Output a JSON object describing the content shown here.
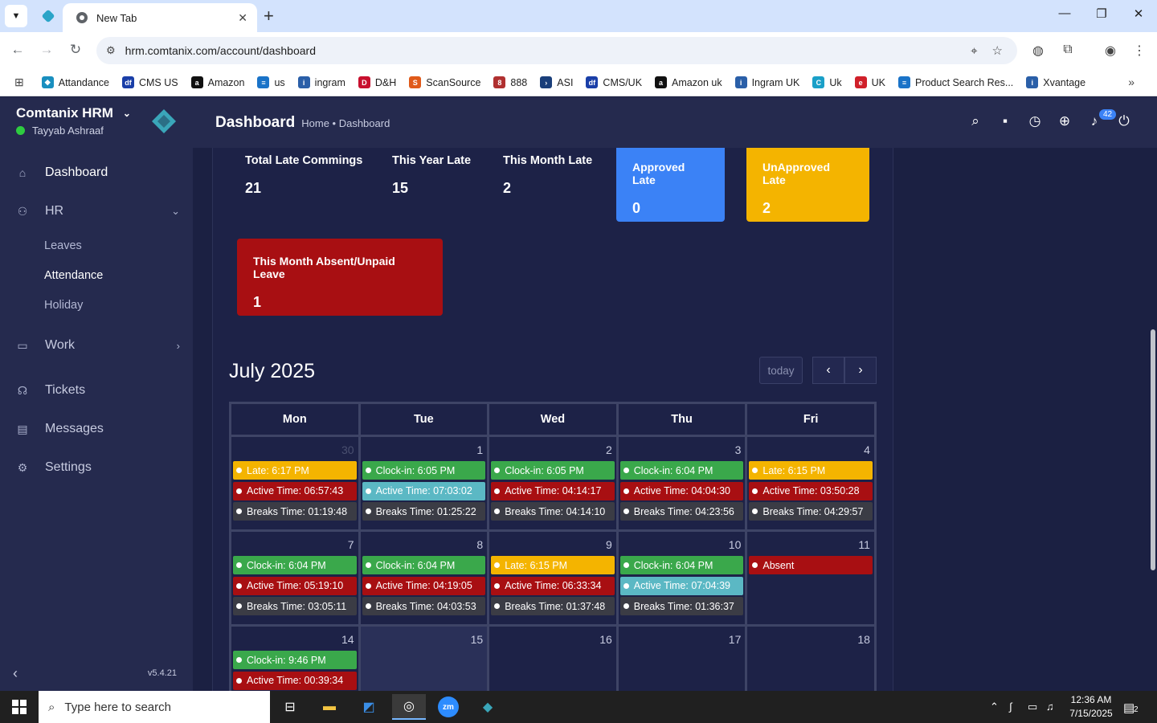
{
  "browser": {
    "tab_title": "New Tab",
    "url": "hrm.comtanix.com/account/dashboard",
    "bookmarks": [
      {
        "label": "Attandance",
        "color": "#1a8fbf",
        "glyph": "◆"
      },
      {
        "label": "CMS US",
        "color": "#1a3fa8",
        "glyph": "df"
      },
      {
        "label": "Amazon",
        "color": "#111111",
        "glyph": "a"
      },
      {
        "label": "us",
        "color": "#1a73c8",
        "glyph": "≡"
      },
      {
        "label": "ingram",
        "color": "#2a5fa8",
        "glyph": "i"
      },
      {
        "label": "D&H",
        "color": "#c8102e",
        "glyph": "D"
      },
      {
        "label": "ScanSource",
        "color": "#e05a1a",
        "glyph": "S"
      },
      {
        "label": "888",
        "color": "#b03030",
        "glyph": "8"
      },
      {
        "label": "ASI",
        "color": "#1a3f7a",
        "glyph": "›"
      },
      {
        "label": "CMS/UK",
        "color": "#1a3fa8",
        "glyph": "df"
      },
      {
        "label": "Amazon uk",
        "color": "#111111",
        "glyph": "a"
      },
      {
        "label": "Ingram UK",
        "color": "#2a5fa8",
        "glyph": "i"
      },
      {
        "label": "Uk",
        "color": "#1aa0c8",
        "glyph": "C"
      },
      {
        "label": "UK",
        "color": "#d0202a",
        "glyph": "e"
      },
      {
        "label": "Product Search Res...",
        "color": "#1a73c8",
        "glyph": "≡"
      },
      {
        "label": "Xvantage",
        "color": "#2a5fa8",
        "glyph": "i"
      }
    ]
  },
  "sidebar": {
    "brand": "Comtanix HRM",
    "user": "Tayyab Ashraaf",
    "nav": {
      "dashboard": "Dashboard",
      "hr": "HR",
      "leaves": "Leaves",
      "attendance": "Attendance",
      "holiday": "Holiday",
      "work": "Work",
      "tickets": "Tickets",
      "messages": "Messages",
      "settings": "Settings"
    },
    "version": "v5.4.21"
  },
  "header": {
    "title": "Dashboard",
    "breadcrumb": "Home • Dashboard",
    "notification_count": "42"
  },
  "stats": {
    "total_late": {
      "label": "Total Late Commings",
      "value": "21"
    },
    "year_late": {
      "label": "This Year Late",
      "value": "15"
    },
    "month_late": {
      "label": "This Month Late",
      "value": "2"
    },
    "approved_late": {
      "label": "Approved Late",
      "value": "0",
      "color": "#3b82f6"
    },
    "unapproved_late": {
      "label": "UnApproved Late",
      "value": "2",
      "color": "#f4b400"
    },
    "month_absent": {
      "label": "This Month Absent/Unpaid Leave",
      "value": "1",
      "color": "#a80f12"
    }
  },
  "calendar": {
    "title": "July 2025",
    "today_label": "today",
    "weekdays": [
      "Mon",
      "Tue",
      "Wed",
      "Thu",
      "Fri"
    ],
    "weeks": [
      [
        {
          "day": "30",
          "other": true,
          "events": [
            {
              "text": "Late: 6:17 PM",
              "kind": "yellow"
            },
            {
              "text": "Active Time: 06:57:43",
              "kind": "red"
            },
            {
              "text": "Breaks Time: 01:19:48",
              "kind": "gray"
            }
          ]
        },
        {
          "day": "1",
          "events": [
            {
              "text": "Clock-in: 6:05 PM",
              "kind": "green"
            },
            {
              "text": "Active Time: 07:03:02",
              "kind": "teal"
            },
            {
              "text": "Breaks Time: 01:25:22",
              "kind": "gray"
            }
          ]
        },
        {
          "day": "2",
          "events": [
            {
              "text": "Clock-in: 6:05 PM",
              "kind": "green"
            },
            {
              "text": "Active Time: 04:14:17",
              "kind": "red"
            },
            {
              "text": "Breaks Time: 04:14:10",
              "kind": "gray"
            }
          ]
        },
        {
          "day": "3",
          "events": [
            {
              "text": "Clock-in: 6:04 PM",
              "kind": "green"
            },
            {
              "text": "Active Time: 04:04:30",
              "kind": "red"
            },
            {
              "text": "Breaks Time: 04:23:56",
              "kind": "gray"
            }
          ]
        },
        {
          "day": "4",
          "events": [
            {
              "text": "Late: 6:15 PM",
              "kind": "yellow"
            },
            {
              "text": "Active Time: 03:50:28",
              "kind": "red"
            },
            {
              "text": "Breaks Time: 04:29:57",
              "kind": "gray"
            }
          ]
        }
      ],
      [
        {
          "day": "7",
          "events": [
            {
              "text": "Clock-in: 6:04 PM",
              "kind": "green"
            },
            {
              "text": "Active Time: 05:19:10",
              "kind": "red"
            },
            {
              "text": "Breaks Time: 03:05:11",
              "kind": "gray"
            }
          ]
        },
        {
          "day": "8",
          "events": [
            {
              "text": "Clock-in: 6:04 PM",
              "kind": "green"
            },
            {
              "text": "Active Time: 04:19:05",
              "kind": "red"
            },
            {
              "text": "Breaks Time: 04:03:53",
              "kind": "gray"
            }
          ]
        },
        {
          "day": "9",
          "events": [
            {
              "text": "Late: 6:15 PM",
              "kind": "yellow"
            },
            {
              "text": "Active Time: 06:33:34",
              "kind": "red"
            },
            {
              "text": "Breaks Time: 01:37:48",
              "kind": "gray"
            }
          ]
        },
        {
          "day": "10",
          "events": [
            {
              "text": "Clock-in: 6:04 PM",
              "kind": "green"
            },
            {
              "text": "Active Time: 07:04:39",
              "kind": "teal"
            },
            {
              "text": "Breaks Time: 01:36:37",
              "kind": "gray"
            }
          ]
        },
        {
          "day": "11",
          "events": [
            {
              "text": "Absent",
              "kind": "red"
            }
          ]
        }
      ],
      [
        {
          "day": "14",
          "events": [
            {
              "text": "Clock-in: 9:46 PM",
              "kind": "green"
            },
            {
              "text": "Active Time: 00:39:34",
              "kind": "red"
            }
          ]
        },
        {
          "day": "15",
          "today": true,
          "events": []
        },
        {
          "day": "16",
          "events": []
        },
        {
          "day": "17",
          "events": []
        },
        {
          "day": "18",
          "events": []
        }
      ]
    ]
  },
  "taskbar": {
    "search_placeholder": "Type here to search",
    "time": "12:36 AM",
    "date": "7/15/2025",
    "notif_count": "2"
  }
}
